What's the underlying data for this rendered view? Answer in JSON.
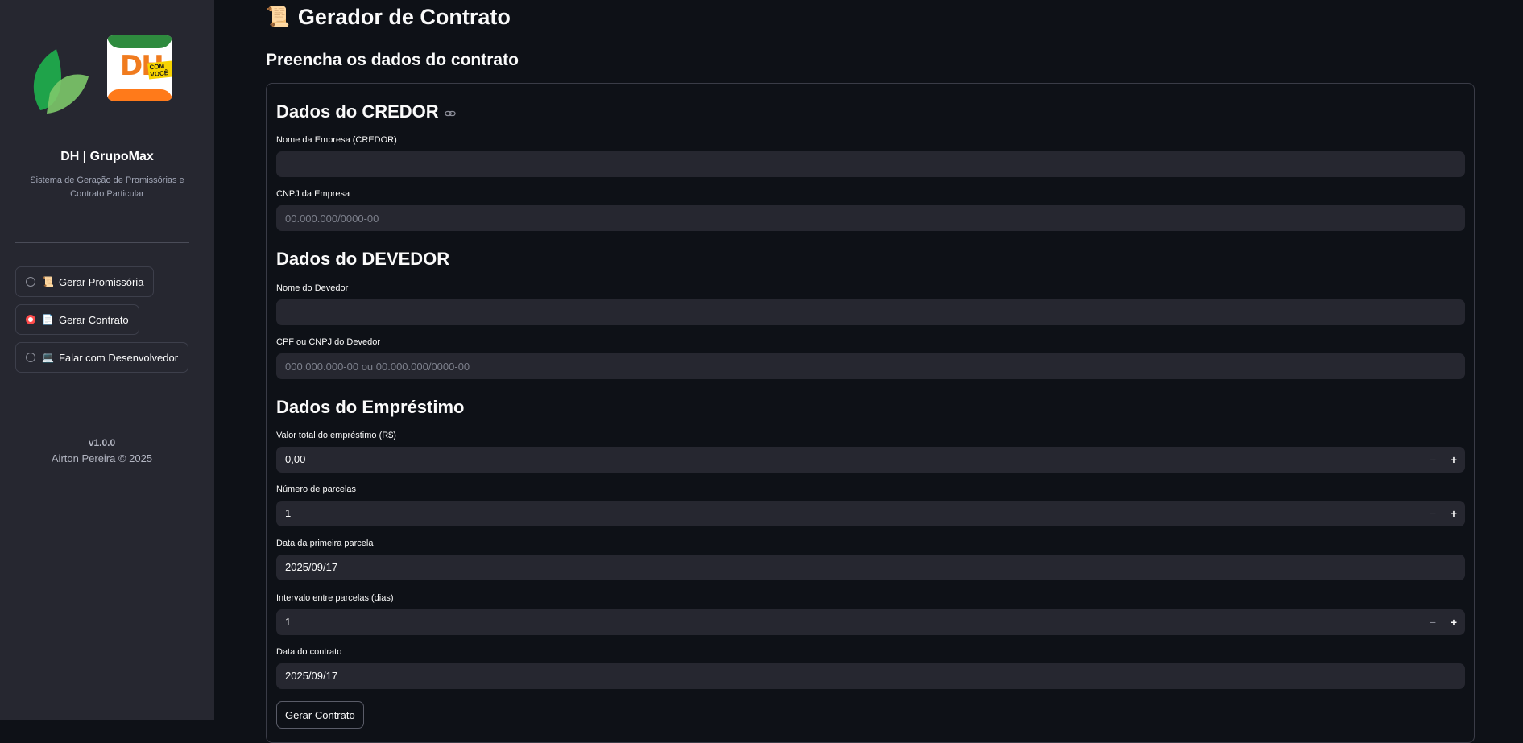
{
  "sidebar": {
    "brand_title": "DH | GrupoMax",
    "brand_subtitle": "Sistema de Geração de Promissórias e Contrato Particular",
    "nav": [
      {
        "icon": "scroll-icon",
        "emoji": "📜",
        "label": "Gerar Promissória",
        "selected": false
      },
      {
        "icon": "document-icon",
        "emoji": "📄",
        "label": "Gerar Contrato",
        "selected": true
      },
      {
        "icon": "computer-icon",
        "emoji": "💻",
        "label": "Falar com Desenvolvedor",
        "selected": false
      }
    ],
    "version": "v1.0.0",
    "copyright": "Airton Pereira © 2025"
  },
  "main": {
    "title_emoji": "📜",
    "title": "Gerador de Contrato",
    "subtitle": "Preencha os dados do contrato",
    "credor": {
      "heading": "Dados do CREDOR",
      "empresa_label": "Nome da Empresa (CREDOR)",
      "empresa_value": "",
      "cnpj_label": "CNPJ da Empresa",
      "cnpj_placeholder": "00.000.000/0000-00"
    },
    "devedor": {
      "heading": "Dados do DEVEDOR",
      "nome_label": "Nome do Devedor",
      "nome_value": "",
      "doc_label": "CPF ou CNPJ do Devedor",
      "doc_placeholder": "000.000.000-00 ou 00.000.000/0000-00"
    },
    "emprestimo": {
      "heading": "Dados do Empréstimo",
      "valor_label": "Valor total do empréstimo (R$)",
      "valor_value": "0,00",
      "parcelas_label": "Número de parcelas",
      "parcelas_value": "1",
      "primeira_label": "Data da primeira parcela",
      "primeira_value": "2025/09/17",
      "intervalo_label": "Intervalo entre parcelas (dias)",
      "intervalo_value": "1",
      "data_contrato_label": "Data do contrato",
      "data_contrato_value": "2025/09/17"
    },
    "submit_label": "Gerar Contrato",
    "stepper_minus": "−",
    "stepper_plus": "+"
  },
  "colors": {
    "background": "#0e1117",
    "sidebar": "#262730",
    "input": "#262730",
    "accent": "#ff4b4b"
  }
}
